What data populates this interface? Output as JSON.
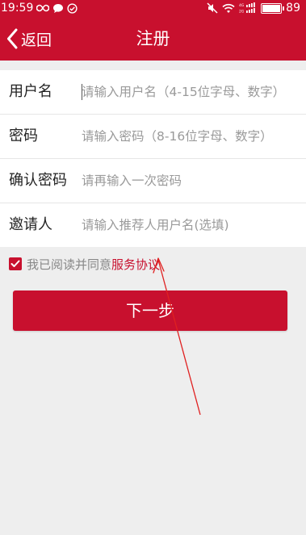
{
  "status_bar": {
    "time": "19:59",
    "battery_level": "89",
    "battery_fraction": 0.89
  },
  "navbar": {
    "back_label": "返回",
    "title": "注册"
  },
  "form": {
    "rows": [
      {
        "label": "用户名",
        "placeholder": "请输入用户名（4-15位字母、数字）",
        "value": ""
      },
      {
        "label": "密码",
        "placeholder": "请输入密码（8-16位字母、数字）",
        "value": ""
      },
      {
        "label": "确认密码",
        "placeholder": "请再输入一次密码",
        "value": ""
      },
      {
        "label": "邀请人",
        "placeholder": "请输入推荐人用户名(选填)",
        "value": ""
      }
    ]
  },
  "agreement": {
    "checked": true,
    "text": "我已阅读并同意",
    "link": "服务协议"
  },
  "next_button": "下一步",
  "colors": {
    "brand": "#c8102e",
    "background": "#eeeeee",
    "placeholder": "#9a9a9a"
  }
}
